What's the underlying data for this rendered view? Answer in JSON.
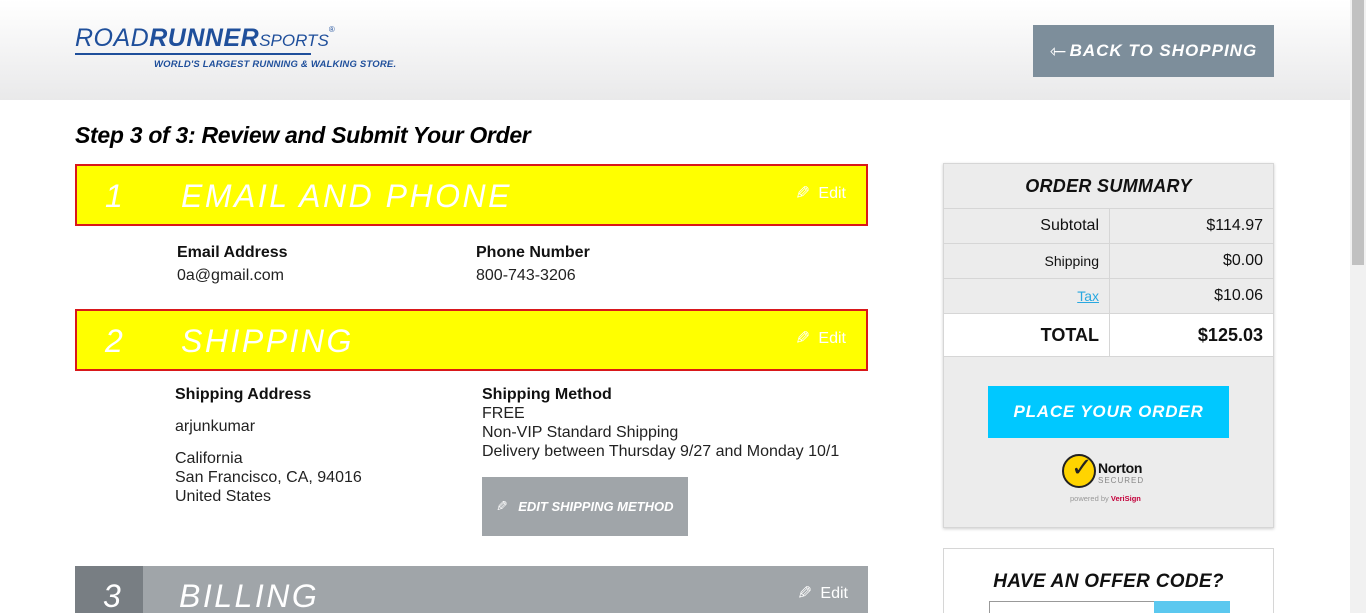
{
  "header": {
    "logo": {
      "road": "ROAD",
      "runner": "RUNNER",
      "sports": "SPORTS",
      "reg": "®",
      "tagline": "WORLD'S LARGEST RUNNING & WALKING STORE."
    },
    "back_arrow": "⇽",
    "back_label": "BACK TO SHOPPING"
  },
  "page_title": "Step 3 of 3: Review and Submit Your Order",
  "sections": [
    {
      "number": "1",
      "title": "EMAIL AND PHONE",
      "edit_label": "Edit"
    },
    {
      "number": "2",
      "title": "SHIPPING",
      "edit_label": "Edit"
    },
    {
      "number": "3",
      "title": "BILLING",
      "edit_label": "Edit"
    }
  ],
  "email_phone": {
    "email_label": "Email Address",
    "email_value": "0a@gmail.com",
    "phone_label": "Phone Number",
    "phone_value": "800-743-3206"
  },
  "shipping": {
    "address_label": "Shipping Address",
    "name": "arjunkumar",
    "address_line1": "California",
    "address_line2": "San Francisco, CA, 94016",
    "address_line3": "United States",
    "method_label": "Shipping Method",
    "method_price": "FREE",
    "method_name": "Non-VIP Standard Shipping",
    "method_delivery": "Delivery between Thursday 9/27 and Monday 10/1",
    "edit_method_label": "EDIT SHIPPING METHOD"
  },
  "summary": {
    "title": "ORDER SUMMARY",
    "rows": [
      {
        "label": "Subtotal",
        "value": "$114.97"
      },
      {
        "label": "Shipping",
        "value": "$0.00"
      },
      {
        "label": "Tax",
        "value": "$10.06"
      }
    ],
    "total_label": "TOTAL",
    "total_value": "$125.03",
    "place_order_label": "PLACE YOUR ORDER",
    "norton": {
      "name": "Norton",
      "secured": "SECURED",
      "powered": "powered by",
      "verisign": "VeriSign"
    }
  },
  "offer": {
    "title": "HAVE AN OFFER CODE?"
  },
  "colors": {
    "accent_yellow": "#ffff00",
    "border_red": "#d9181a",
    "cta_blue": "#00c8ff",
    "brand_blue": "#1f4f9b",
    "button_gray": "#7d8e9b"
  }
}
